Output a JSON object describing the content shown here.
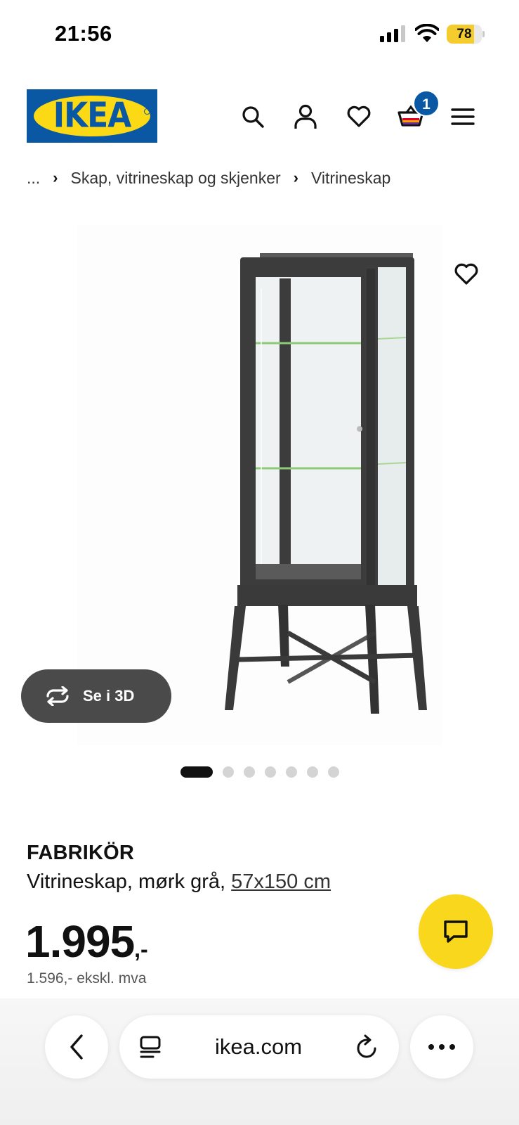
{
  "status_bar": {
    "time": "21:56",
    "battery_level": "78",
    "icons": [
      "signal-icon",
      "wifi-icon",
      "battery-icon"
    ]
  },
  "header": {
    "logo_text": "IKEA",
    "icons": [
      "search-icon",
      "user-icon",
      "heart-icon",
      "cart-icon",
      "menu-icon"
    ],
    "cart_count": "1",
    "brand_colors": {
      "blue": "#0a58a3",
      "yellow": "#fbd914"
    }
  },
  "breadcrumb": {
    "ellipsis": "...",
    "items": [
      "Skap, vitrineskap og skjenker",
      "Vitrineskap"
    ]
  },
  "gallery": {
    "see_3d_label": "Se i 3D",
    "total_images": 7,
    "active_index": 0
  },
  "product": {
    "name": "FABRIKÖR",
    "description": "Vitrineskap, mørk grå,",
    "size": "57x150 cm",
    "price": "1.995",
    "price_suffix": ",-",
    "price_ex_vat": "1.596,- ekskl. mva"
  },
  "browser": {
    "url": "ikea.com",
    "icons": [
      "back-icon",
      "reader-icon",
      "reload-icon",
      "more-icon"
    ]
  },
  "chat": {
    "icon": "chat-icon",
    "color": "#f9d71c"
  }
}
